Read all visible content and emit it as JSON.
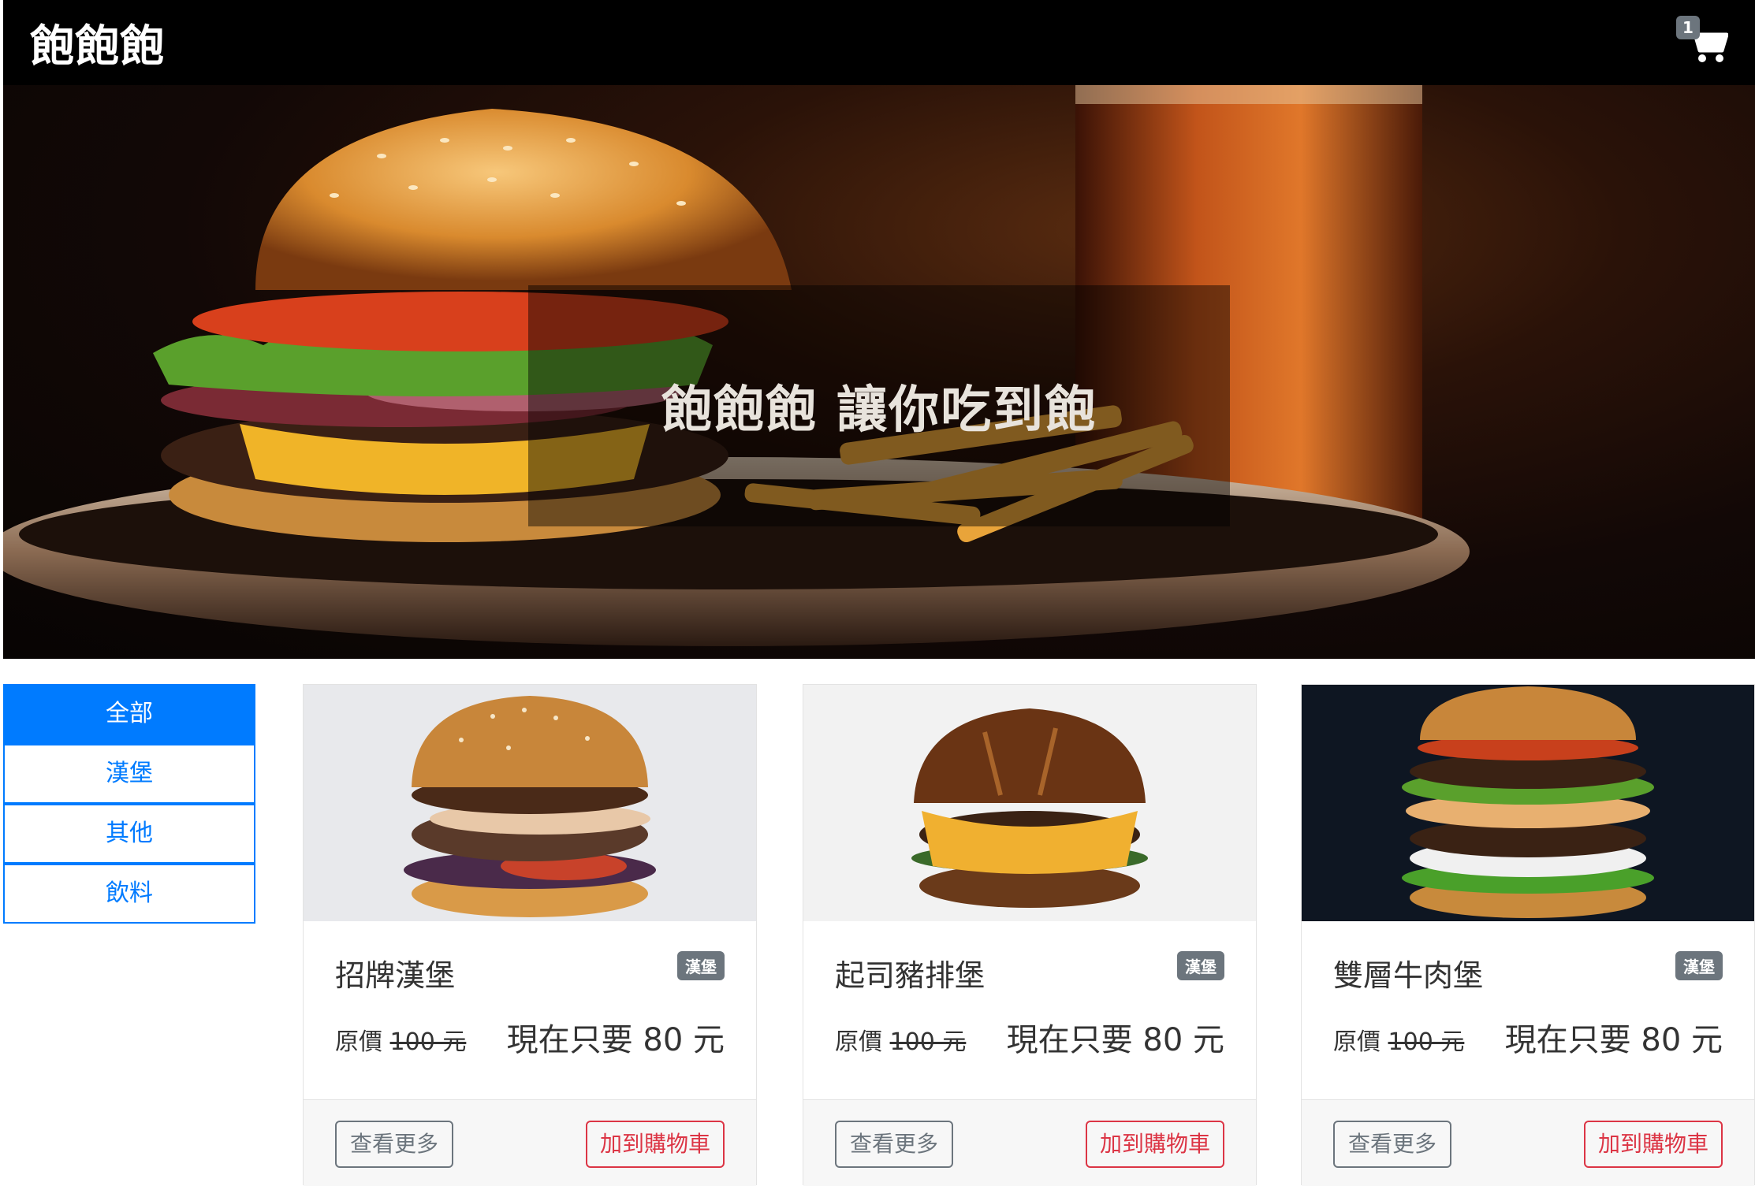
{
  "navbar": {
    "brand": "飽飽飽",
    "cart_count": "1",
    "cart_icon": "cart-icon"
  },
  "hero": {
    "tagline": "飽飽飽 讓你吃到飽"
  },
  "sidebar": {
    "items": [
      {
        "label": "全部",
        "active": true
      },
      {
        "label": "漢堡",
        "active": false
      },
      {
        "label": "其他",
        "active": false
      },
      {
        "label": "飲料",
        "active": false
      }
    ]
  },
  "products": [
    {
      "title": "招牌漢堡",
      "badge": "漢堡",
      "orig_prefix": "原價",
      "orig_price": "100 元",
      "price": "現在只要 80 元",
      "more": "查看更多",
      "add": "加到購物車"
    },
    {
      "title": "起司豬排堡",
      "badge": "漢堡",
      "orig_prefix": "原價",
      "orig_price": "100 元",
      "price": "現在只要 80 元",
      "more": "查看更多",
      "add": "加到購物車"
    },
    {
      "title": "雙層牛肉堡",
      "badge": "漢堡",
      "orig_prefix": "原價",
      "orig_price": "100 元",
      "price": "現在只要 80 元",
      "more": "查看更多",
      "add": "加到購物車"
    }
  ],
  "colors": {
    "primary": "#007bff",
    "danger": "#dc3545",
    "secondary": "#6c757d"
  }
}
